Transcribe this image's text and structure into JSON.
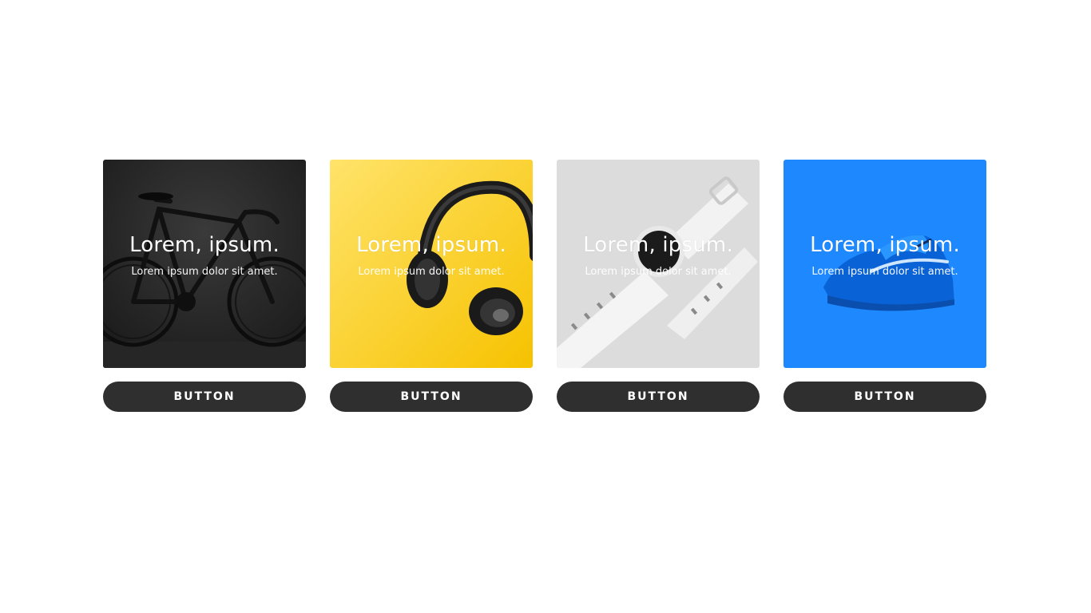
{
  "cards": [
    {
      "title": "Lorem, ipsum.",
      "subtitle": "Lorem ipsum dolor sit amet.",
      "button_label": "BUTTON",
      "image": "bicycle",
      "background": "#2a2a2a"
    },
    {
      "title": "Lorem, ipsum.",
      "subtitle": "Lorem ipsum dolor sit amet.",
      "button_label": "BUTTON",
      "image": "headphones",
      "background": "#fdd835"
    },
    {
      "title": "Lorem, ipsum.",
      "subtitle": "Lorem ipsum dolor sit amet.",
      "button_label": "BUTTON",
      "image": "wristwatch",
      "background": "#dcdcdc"
    },
    {
      "title": "Lorem, ipsum.",
      "subtitle": "Lorem ipsum dolor sit amet.",
      "button_label": "BUTTON",
      "image": "sneaker",
      "background": "#1e88ff"
    }
  ],
  "colors": {
    "button_bg": "#2f2f2f",
    "button_text": "#ffffff",
    "overlay_text": "#ffffff"
  }
}
